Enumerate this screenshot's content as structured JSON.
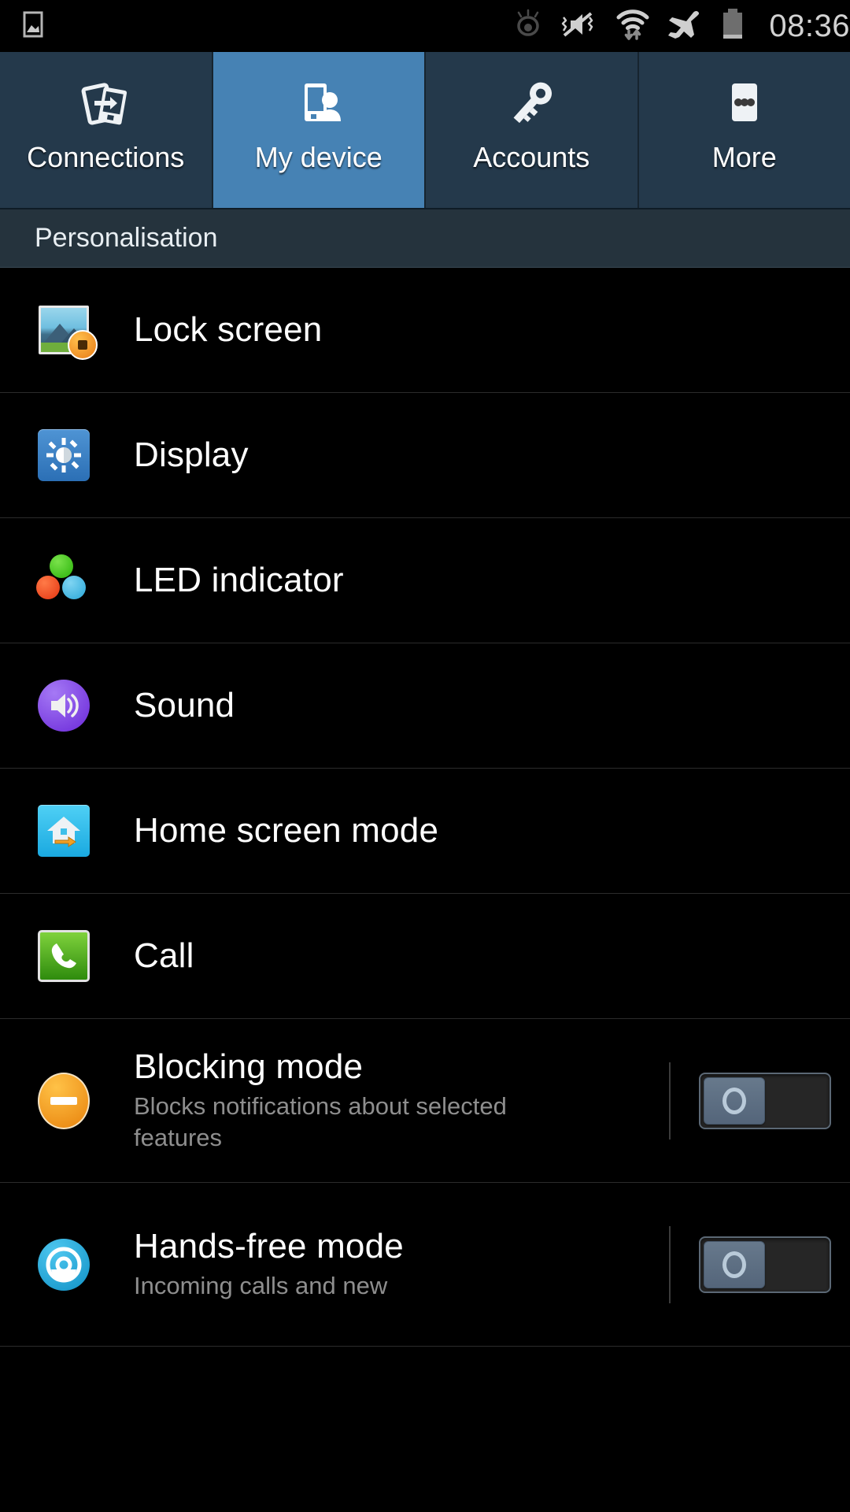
{
  "status_bar": {
    "left_icons": [
      {
        "name": "image-icon"
      }
    ],
    "right_icons": [
      {
        "name": "eye-smart-stay-icon"
      },
      {
        "name": "mute-vibrate-off-icon"
      },
      {
        "name": "wifi-data-transfer-icon"
      },
      {
        "name": "airplane-mode-icon"
      },
      {
        "name": "battery-icon"
      }
    ],
    "clock": "08:36"
  },
  "tabs": [
    {
      "label": "Connections",
      "icon": "connections-icon",
      "active": false
    },
    {
      "label": "My device",
      "icon": "my-device-icon",
      "active": true
    },
    {
      "label": "Accounts",
      "icon": "accounts-key-icon",
      "active": false
    },
    {
      "label": "More",
      "icon": "more-dots-icon",
      "active": false
    }
  ],
  "section": {
    "title": "Personalisation"
  },
  "list_items": [
    {
      "title": "Lock screen",
      "subtitle": "",
      "icon": "lock-screen-icon",
      "has_toggle": false,
      "toggle_on": false
    },
    {
      "title": "Display",
      "subtitle": "",
      "icon": "display-icon",
      "has_toggle": false,
      "toggle_on": false
    },
    {
      "title": "LED indicator",
      "subtitle": "",
      "icon": "led-indicator-icon",
      "has_toggle": false,
      "toggle_on": false
    },
    {
      "title": "Sound",
      "subtitle": "",
      "icon": "sound-icon",
      "has_toggle": false,
      "toggle_on": false
    },
    {
      "title": "Home screen mode",
      "subtitle": "",
      "icon": "home-screen-mode-icon",
      "has_toggle": false,
      "toggle_on": false
    },
    {
      "title": "Call",
      "subtitle": "",
      "icon": "call-icon",
      "has_toggle": false,
      "toggle_on": false
    },
    {
      "title": "Blocking mode",
      "subtitle": "Blocks notifications about selected features",
      "icon": "blocking-mode-icon",
      "has_toggle": true,
      "toggle_on": false
    },
    {
      "title": "Hands-free mode",
      "subtitle": "Incoming calls and new",
      "icon": "hands-free-mode-icon",
      "has_toggle": true,
      "toggle_on": false
    }
  ],
  "colors": {
    "tab_bar": "#24394b",
    "tab_active": "#4682b4",
    "section_header": "#25333d",
    "page_background": "#000000",
    "title_text": "#ffffff",
    "subtitle_text": "#8e8e8e",
    "status_text": "#d2d2d2"
  }
}
